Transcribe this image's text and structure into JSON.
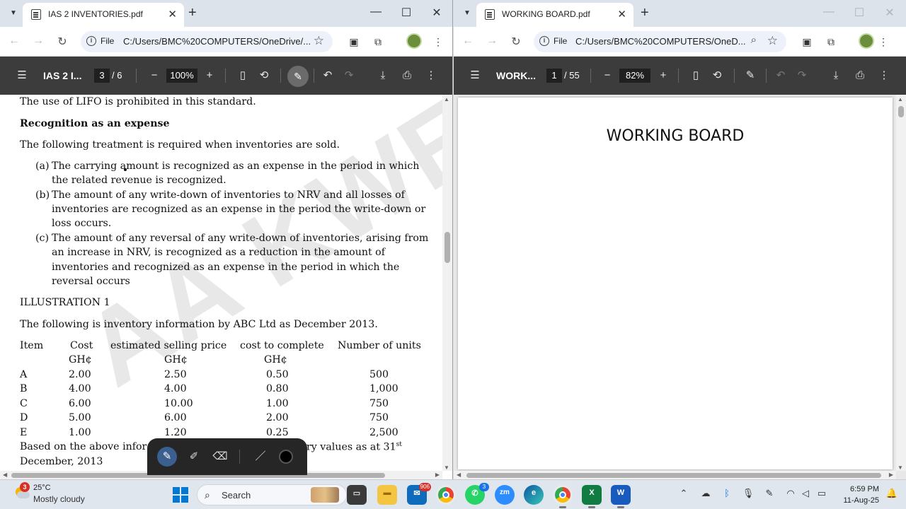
{
  "left_window": {
    "tab_title": "IAS 2 INVENTORIES.pdf",
    "scheme": "File",
    "url": "C:/Users/BMC%20COMPUTERS/OneDrive/...",
    "pdf_title": "IAS 2 I...",
    "page_current": "3",
    "page_total": "/ 6",
    "zoom": "100%",
    "doc": {
      "line1": "The use of LIFO is prohibited in this standard.",
      "heading": "Recognition as an expense",
      "intro": "The following treatment is required when inventories are sold.",
      "items": [
        {
          "marker": "(a)",
          "lines": [
            "The carrying amount is recognized as an expense in the period in which",
            "the related revenue is recognized."
          ]
        },
        {
          "marker": "(b)",
          "lines": [
            "The amount of any write-down of inventories to NRV and all losses of",
            "inventories are recognized as an expense in the period the write-down or",
            "loss occurs."
          ]
        },
        {
          "marker": "(c)",
          "lines": [
            "The amount of any reversal of any write-down of inventories, arising from",
            "an increase in NRV, is recognized as a reduction in the amount of",
            "inventories and recognized as an expense in the period in which the",
            "reversal occurs"
          ]
        }
      ],
      "illustration": "ILLUSTRATION 1",
      "illus_intro": "The following is inventory information by ABC Ltd as December 2013.",
      "table": {
        "headers": [
          "Item",
          "Cost",
          "estimated selling price",
          "cost to complete",
          "Number of units"
        ],
        "units": [
          "",
          "GH¢",
          "GH¢",
          "GH¢",
          ""
        ],
        "rows": [
          [
            "A",
            "2.00",
            "2.50",
            "0.50",
            "500"
          ],
          [
            "B",
            "4.00",
            "4.00",
            "0.80",
            "1,000"
          ],
          [
            "C",
            "6.00",
            "10.00",
            "1.00",
            "750"
          ],
          [
            "D",
            "5.00",
            "6.00",
            "2.00",
            "750"
          ],
          [
            "E",
            "1.00",
            "1.20",
            "0.25",
            "2,500"
          ]
        ]
      },
      "footer_left": "Based on the above infor",
      "footer_right": "ry values as at 31",
      "footer_sup": "st",
      "footer_line2": "December, 2013",
      "watermark": "AA KWESI"
    }
  },
  "right_window": {
    "tab_title": "WORKING BOARD.pdf",
    "scheme": "File",
    "url": "C:/Users/BMC%20COMPUTERS/OneD...",
    "pdf_title": "WORK...",
    "page_current": "1",
    "page_total": "/ 55",
    "zoom": "82%",
    "page_heading": "WORKING BOARD"
  },
  "taskbar": {
    "weather_badge": "3",
    "temperature": "25°C",
    "condition": "Mostly cloudy",
    "search_placeholder": "Search",
    "mail_badge": "906",
    "whatsapp_badge": "3",
    "zoom_label": "zm",
    "excel_label": "X",
    "word_label": "W",
    "time": "6:59 PM",
    "date": "11-Aug-25"
  },
  "colors": {
    "pdf_toolbar": "#3c3c3c",
    "tab_strip": "#dde3ea",
    "taskbar": "#dfe6ee",
    "accent": "#0078d4"
  }
}
